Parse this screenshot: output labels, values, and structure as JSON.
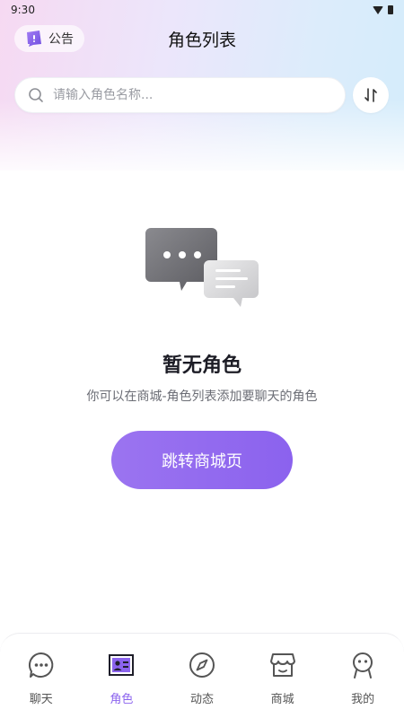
{
  "status_bar": {
    "time": "9:30"
  },
  "header": {
    "notice_label": "公告",
    "title": "角色列表"
  },
  "search": {
    "placeholder": "请输入角色名称...",
    "value": ""
  },
  "empty_state": {
    "title": "暂无角色",
    "description": "你可以在商城-角色列表添加要聊天的角色",
    "button_label": "跳转商城页"
  },
  "tabs": [
    {
      "label": "聊天",
      "icon": "chat-bubble-icon",
      "active": false
    },
    {
      "label": "角色",
      "icon": "id-card-icon",
      "active": true
    },
    {
      "label": "动态",
      "icon": "compass-icon",
      "active": false
    },
    {
      "label": "商城",
      "icon": "store-icon",
      "active": false
    },
    {
      "label": "我的",
      "icon": "person-icon",
      "active": false
    }
  ],
  "colors": {
    "accent": "#8c64ee",
    "button_gradient_start": "#9b74f0",
    "button_gradient_end": "#8b62ee"
  }
}
